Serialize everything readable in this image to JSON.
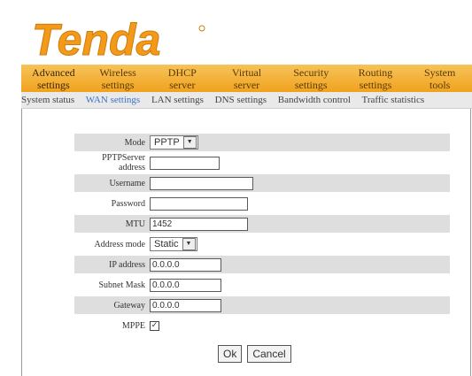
{
  "brand": {
    "logo_text": "Tenda",
    "color": "#f39a1a"
  },
  "tabs": [
    {
      "line1": "Advanced",
      "line2": "settings"
    },
    {
      "line1": "Wireless",
      "line2": "settings"
    },
    {
      "line1": "DHCP",
      "line2": "server"
    },
    {
      "line1": "Virtual",
      "line2": "server"
    },
    {
      "line1": "Security",
      "line2": "settings"
    },
    {
      "line1": "Routing",
      "line2": "settings"
    },
    {
      "line1": "System",
      "line2": "tools"
    }
  ],
  "subnav": [
    "System status",
    "WAN settings",
    "LAN settings",
    "DNS settings",
    "Bandwidth control",
    "Traffic statistics"
  ],
  "form": {
    "mode_label": "Mode",
    "mode_value": "PPTP",
    "server_label": "PPTPServer address",
    "server_value": "",
    "username_label": "Username",
    "username_value": "",
    "password_label": "Password",
    "password_value": "",
    "mtu_label": "MTU",
    "mtu_value": "1452",
    "addrmode_label": "Address mode",
    "addrmode_value": "Static",
    "ip_label": "IP address",
    "ip_value": "0.0.0.0",
    "mask_label": "Subnet Mask",
    "mask_value": "0.0.0.0",
    "gw_label": "Gateway",
    "gw_value": "0.0.0.0",
    "mppe_label": "MPPE",
    "mppe_checked": "✓"
  },
  "buttons": {
    "ok": "Ok",
    "cancel": "Cancel"
  }
}
